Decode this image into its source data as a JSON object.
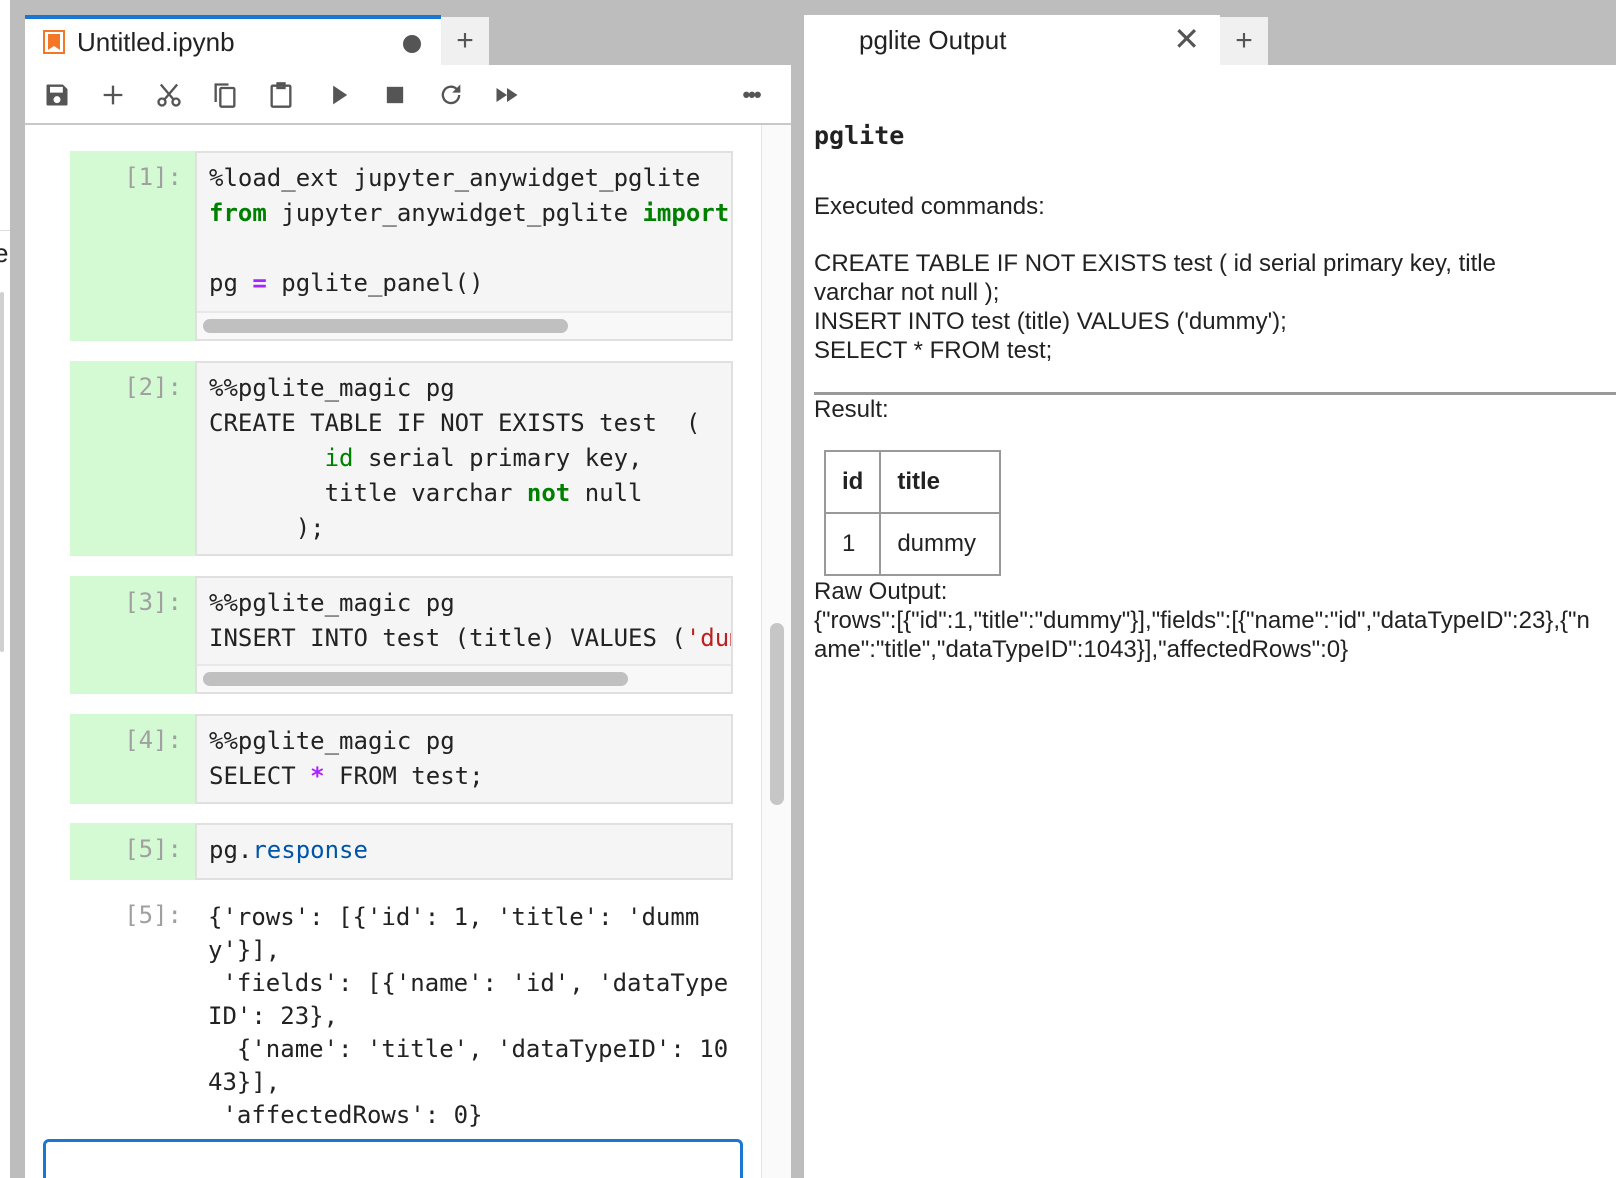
{
  "notebook": {
    "tab_title": "Untitled.ipynb",
    "new_tab_label": "+",
    "toolbar": {
      "buttons": [
        {
          "name": "save-icon",
          "label": "Save"
        },
        {
          "name": "plus-icon",
          "label": "Insert cell"
        },
        {
          "name": "scissors-icon",
          "label": "Cut"
        },
        {
          "name": "copy-icon",
          "label": "Copy"
        },
        {
          "name": "paste-icon",
          "label": "Paste"
        },
        {
          "name": "play-icon",
          "label": "Run"
        },
        {
          "name": "stop-icon",
          "label": "Interrupt"
        },
        {
          "name": "restart-icon",
          "label": "Restart"
        },
        {
          "name": "fast-forward-icon",
          "label": "Restart and run all"
        },
        {
          "name": "more-icon",
          "label": "More"
        }
      ],
      "more_label": "•••"
    },
    "cells": [
      {
        "prompt": "[1]:"
      },
      {
        "prompt": "[2]:"
      },
      {
        "prompt": "[3]:"
      },
      {
        "prompt": "[4]:"
      },
      {
        "prompt": "[5]:"
      }
    ],
    "output": {
      "prompt": "[5]:",
      "text": "{'rows': [{'id': 1, 'title': 'dummy'}],\n 'fields': [{'name': 'id', 'dataTypeID': 23},\n  {'name': 'title', 'dataTypeID': 1043}],\n 'affectedRows': 0}"
    }
  },
  "output_panel": {
    "tab_title": "pglite Output",
    "close_label": "✕",
    "new_tab_label": "+",
    "heading": "pglite",
    "executed_label": "Executed commands:",
    "commands": [
      "CREATE TABLE IF NOT EXISTS test ( id serial primary key, title varchar not null );",
      "INSERT INTO test (title) VALUES ('dummy');",
      "SELECT * FROM test;"
    ],
    "result_label": "Result:",
    "table": {
      "headers": [
        "id",
        "title"
      ],
      "rows": [
        [
          "1",
          "dummy"
        ]
      ]
    },
    "raw_label": "Raw Output:",
    "raw_text": "{\"rows\":[{\"id\":1,\"title\":\"dummy\"}],\"fields\":[{\"name\":\"id\",\"dataTypeID\":23},{\"name\":\"title\",\"dataTypeID\":1043}],\"affectedRows\":0}"
  },
  "code": {
    "c1": {
      "l1": "%load_ext jupyter_anywidget_pglite",
      "l2_kw": "from",
      "l2_mid": " jupyter_anywidget_pglite ",
      "l2_kw2": "import",
      "l4a": "pg ",
      "l4op": "=",
      "l4b": " pglite_panel()"
    },
    "c2": {
      "l1": "%%pglite_magic pg",
      "l2": "CREATE TABLE IF NOT EXISTS test  (",
      "l3a": "        ",
      "l3id": "id",
      "l3b": " serial primary key,",
      "l4a": "        title varchar ",
      "l4kw": "not",
      "l4b": " null",
      "l5": "      );"
    },
    "c3": {
      "l1": "%%pglite_magic pg",
      "l2a": "INSERT INTO test (title) VALUES (",
      "l2str": "'dummy'",
      "l2b": ");"
    },
    "c4": {
      "l1": "%%pglite_magic pg",
      "l2a": "SELECT ",
      "l2op": "*",
      "l2b": " FROM test;"
    },
    "c5": {
      "a": "pg.",
      "b": "response"
    }
  }
}
